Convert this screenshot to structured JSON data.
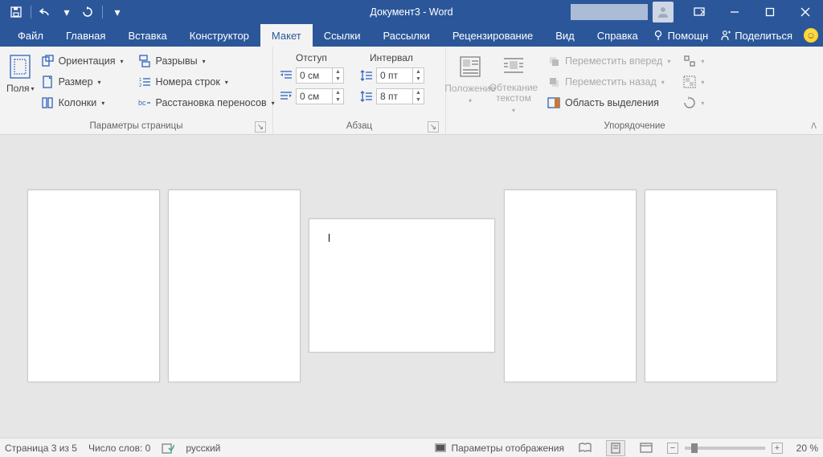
{
  "title": "Документ3 - Word",
  "tabs": [
    "Файл",
    "Главная",
    "Вставка",
    "Конструктор",
    "Макет",
    "Ссылки",
    "Рассылки",
    "Рецензирование",
    "Вид",
    "Справка"
  ],
  "active_tab": 4,
  "help_label": "Помощн",
  "share_label": "Поделиться",
  "ribbon": {
    "page_setup": {
      "margins": "Поля",
      "orientation": "Ориентация",
      "size": "Размер",
      "columns": "Колонки",
      "breaks": "Разрывы",
      "line_numbers": "Номера строк",
      "hyphenation": "Расстановка переносов",
      "caption": "Параметры страницы"
    },
    "paragraph": {
      "indent_label": "Отступ",
      "spacing_label": "Интервал",
      "indent_left": "0 см",
      "indent_right": "0 см",
      "spacing_before": "0 пт",
      "spacing_after": "8 пт",
      "caption": "Абзац"
    },
    "arrange": {
      "position": "Положение",
      "wrap": "Обтекание текстом",
      "bring_forward": "Переместить вперед",
      "send_backward": "Переместить назад",
      "selection_pane": "Область выделения",
      "caption": "Упорядочение"
    }
  },
  "status": {
    "page": "Страница 3 из 5",
    "words": "Число слов: 0",
    "lang": "русский",
    "display_opts": "Параметры отображения",
    "zoom": "20 %"
  }
}
